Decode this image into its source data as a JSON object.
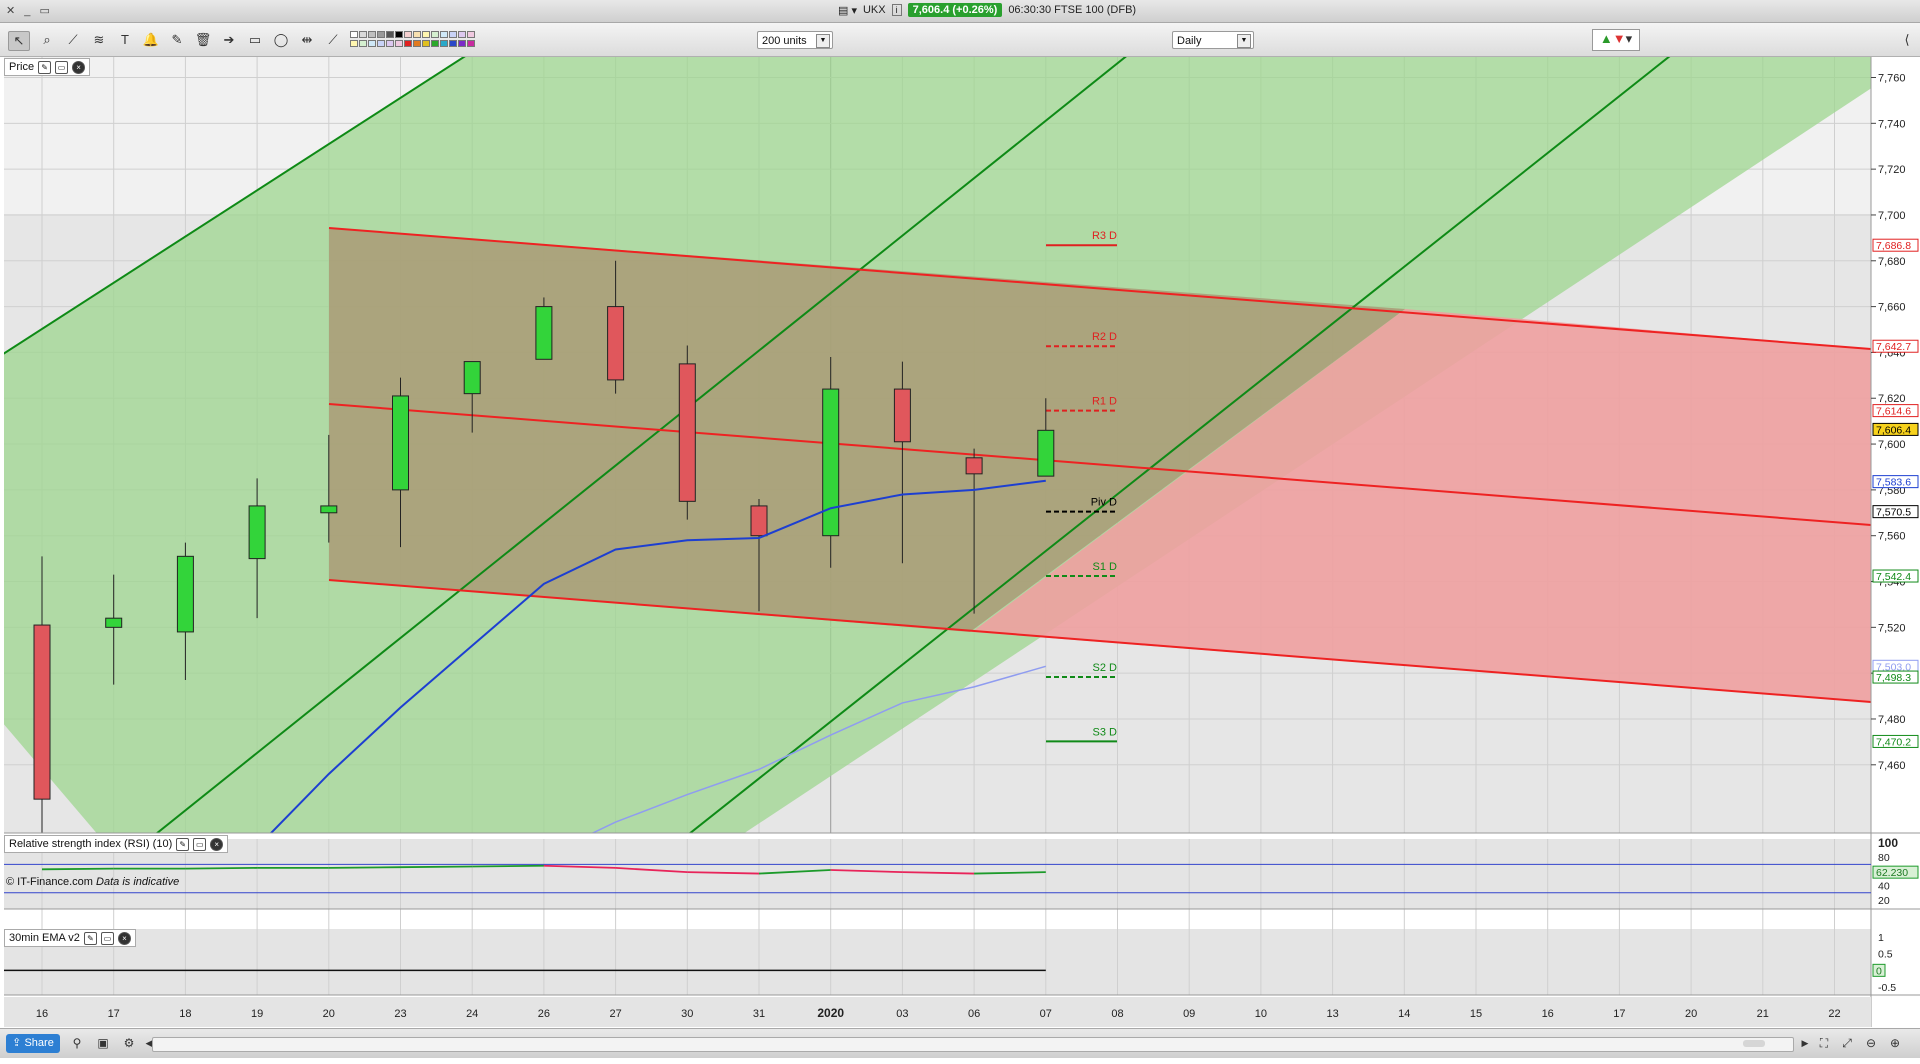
{
  "window": {
    "controls": "✕ _ ▭",
    "symbol": "UKX",
    "price_chip": "7,606.4 (+0.26%)",
    "time_instrument": "06:30:30 FTSE 100 (DFB)"
  },
  "toolbar": {
    "units_select": "200 units",
    "period_select": "Daily"
  },
  "panels": {
    "price_label": "Price",
    "rsi_label": "Relative strength index (RSI) (10)",
    "ema_label": "30min EMA v2",
    "copyright": "© IT-Finance.com",
    "copyright_italic": "Data is indicative"
  },
  "statusbar": {
    "share": "Share"
  },
  "colors": {
    "bull": "#33d43a",
    "bear": "#e0575c",
    "ma_blue": "#1d3fd1",
    "ma_light": "#8f9cf0",
    "trend_green": "#0e8a16",
    "trend_red": "#ee2222",
    "green_fill": "#9dd68f",
    "red_fill": "#eea0a0",
    "brown_fill": "#aa9a75",
    "price_chip": "#29a02e"
  },
  "chart_data": {
    "type": "candlestick",
    "x_labels": [
      "16",
      "17",
      "18",
      "19",
      "20",
      "23",
      "24",
      "26",
      "27",
      "30",
      "31",
      "2020",
      "03",
      "06",
      "07",
      "08",
      "09",
      "10",
      "13",
      "14",
      "15",
      "16",
      "17",
      "20",
      "21",
      "22"
    ],
    "candles": [
      {
        "x": "16",
        "open": 7521,
        "high": 7551,
        "low": 7405,
        "close": 7445
      },
      {
        "x": "17",
        "open": 7520,
        "high": 7543,
        "low": 7495,
        "close": 7524
      },
      {
        "x": "18",
        "open": 7518,
        "high": 7557,
        "low": 7497,
        "close": 7551
      },
      {
        "x": "19",
        "open": 7550,
        "high": 7585,
        "low": 7524,
        "close": 7573
      },
      {
        "x": "20",
        "open": 7570,
        "high": 7604,
        "low": 7557,
        "close": 7573
      },
      {
        "x": "23",
        "open": 7580,
        "high": 7629,
        "low": 7555,
        "close": 7621
      },
      {
        "x": "24",
        "open": 7622,
        "high": 7636,
        "low": 7605,
        "close": 7636
      },
      {
        "x": "26",
        "open": 7637,
        "high": 7664,
        "low": 7637,
        "close": 7660
      },
      {
        "x": "27",
        "open": 7660,
        "high": 7680,
        "low": 7622,
        "close": 7628
      },
      {
        "x": "30",
        "open": 7635,
        "high": 7643,
        "low": 7567,
        "close": 7575
      },
      {
        "x": "31",
        "open": 7573,
        "high": 7576,
        "low": 7527,
        "close": 7560
      },
      {
        "x": "2020",
        "open": 7560,
        "high": 7638,
        "low": 7546,
        "close": 7624
      },
      {
        "x": "03",
        "open": 7624,
        "high": 7636,
        "low": 7548,
        "close": 7601
      },
      {
        "x": "06",
        "open": 7594,
        "high": 7598,
        "low": 7526,
        "close": 7587
      },
      {
        "x": "07",
        "open": 7586,
        "high": 7620,
        "low": 7586,
        "close": 7606
      }
    ],
    "ma_blue": [
      {
        "x": "19",
        "y": 7424
      },
      {
        "x": "20",
        "y": 7456
      },
      {
        "x": "23",
        "y": 7485
      },
      {
        "x": "24",
        "y": 7512
      },
      {
        "x": "26",
        "y": 7539
      },
      {
        "x": "27",
        "y": 7554
      },
      {
        "x": "30",
        "y": 7558
      },
      {
        "x": "31",
        "y": 7559
      },
      {
        "x": "2020",
        "y": 7572
      },
      {
        "x": "03",
        "y": 7578
      },
      {
        "x": "06",
        "y": 7580
      },
      {
        "x": "07",
        "y": 7584
      }
    ],
    "ma_light": [
      {
        "x": "26",
        "y": 7420
      },
      {
        "x": "27",
        "y": 7435
      },
      {
        "x": "30",
        "y": 7447
      },
      {
        "x": "31",
        "y": 7458
      },
      {
        "x": "2020",
        "y": 7473
      },
      {
        "x": "03",
        "y": 7487
      },
      {
        "x": "06",
        "y": 7494
      },
      {
        "x": "07",
        "y": 7503
      }
    ],
    "pivots": [
      {
        "label": "R3 D",
        "value": 7686.8,
        "color": "#e02020",
        "dash": false
      },
      {
        "label": "R2 D",
        "value": 7642.7,
        "color": "#e02020",
        "dash": true
      },
      {
        "label": "R1 D",
        "value": 7614.6,
        "color": "#e02020",
        "dash": true
      },
      {
        "label": "Piv D",
        "value": 7570.5,
        "color": "#000000",
        "dash": true
      },
      {
        "label": "S1 D",
        "value": 7542.4,
        "color": "#108a18",
        "dash": true
      },
      {
        "label": "S2 D",
        "value": 7498.3,
        "color": "#108a18",
        "dash": true
      },
      {
        "label": "S3 D",
        "value": 7470.2,
        "color": "#108a18",
        "dash": false
      }
    ],
    "price_badges": [
      {
        "text": "7,686.8",
        "value": 7686.8,
        "color": "#e02020",
        "fill": "#ffffff"
      },
      {
        "text": "7,642.7",
        "value": 7642.7,
        "color": "#e02020",
        "fill": "#ffffff"
      },
      {
        "text": "7,614.6",
        "value": 7614.6,
        "color": "#e02020",
        "fill": "#ffffff"
      },
      {
        "text": "7,606.4",
        "value": 7606.4,
        "color": "#000000",
        "fill": "#f7d21c"
      },
      {
        "text": "7,583.6",
        "value": 7583.6,
        "color": "#1d3fd1",
        "fill": "#ffffff"
      },
      {
        "text": "7,570.5",
        "value": 7570.5,
        "color": "#000000",
        "fill": "#ffffff"
      },
      {
        "text": "7,542.4",
        "value": 7542.4,
        "color": "#108a18",
        "fill": "#ffffff"
      },
      {
        "text": "7,503.0",
        "value": 7503.0,
        "color": "#8f9cf0",
        "fill": "#ffffff"
      },
      {
        "text": "7,498.3",
        "value": 7498.3,
        "color": "#108a18",
        "fill": "#ffffff"
      },
      {
        "text": "7,470.2",
        "value": 7470.2,
        "color": "#108a18",
        "fill": "#ffffff"
      }
    ],
    "y_ticks": [
      "7,760",
      "7,740",
      "7,720",
      "7,700",
      "7,680",
      "7,660",
      "7,640",
      "7,620",
      "7,600",
      "7,580",
      "7,560",
      "7,540",
      "7,520",
      "7,500",
      "7,480",
      "7,460"
    ],
    "ylim": [
      7420,
      7768
    ],
    "rsi": {
      "ticks": [
        "100",
        "80",
        "60",
        "40",
        "20"
      ],
      "value_label": "62.230",
      "values": [
        {
          "x": "16",
          "y": 63
        },
        {
          "x": "17",
          "y": 64
        },
        {
          "x": "18",
          "y": 64
        },
        {
          "x": "19",
          "y": 65
        },
        {
          "x": "20",
          "y": 65
        },
        {
          "x": "23",
          "y": 66
        },
        {
          "x": "24",
          "y": 67
        },
        {
          "x": "26",
          "y": 68
        },
        {
          "x": "27",
          "y": 65
        },
        {
          "x": "30",
          "y": 59
        },
        {
          "x": "31",
          "y": 57
        },
        {
          "x": "2020",
          "y": 62
        },
        {
          "x": "03",
          "y": 59
        },
        {
          "x": "06",
          "y": 57
        },
        {
          "x": "07",
          "y": 59
        }
      ]
    },
    "ema_panel": {
      "ticks": [
        "1",
        "0.5",
        "0",
        "-0.5"
      ],
      "zero_label": "0"
    }
  }
}
